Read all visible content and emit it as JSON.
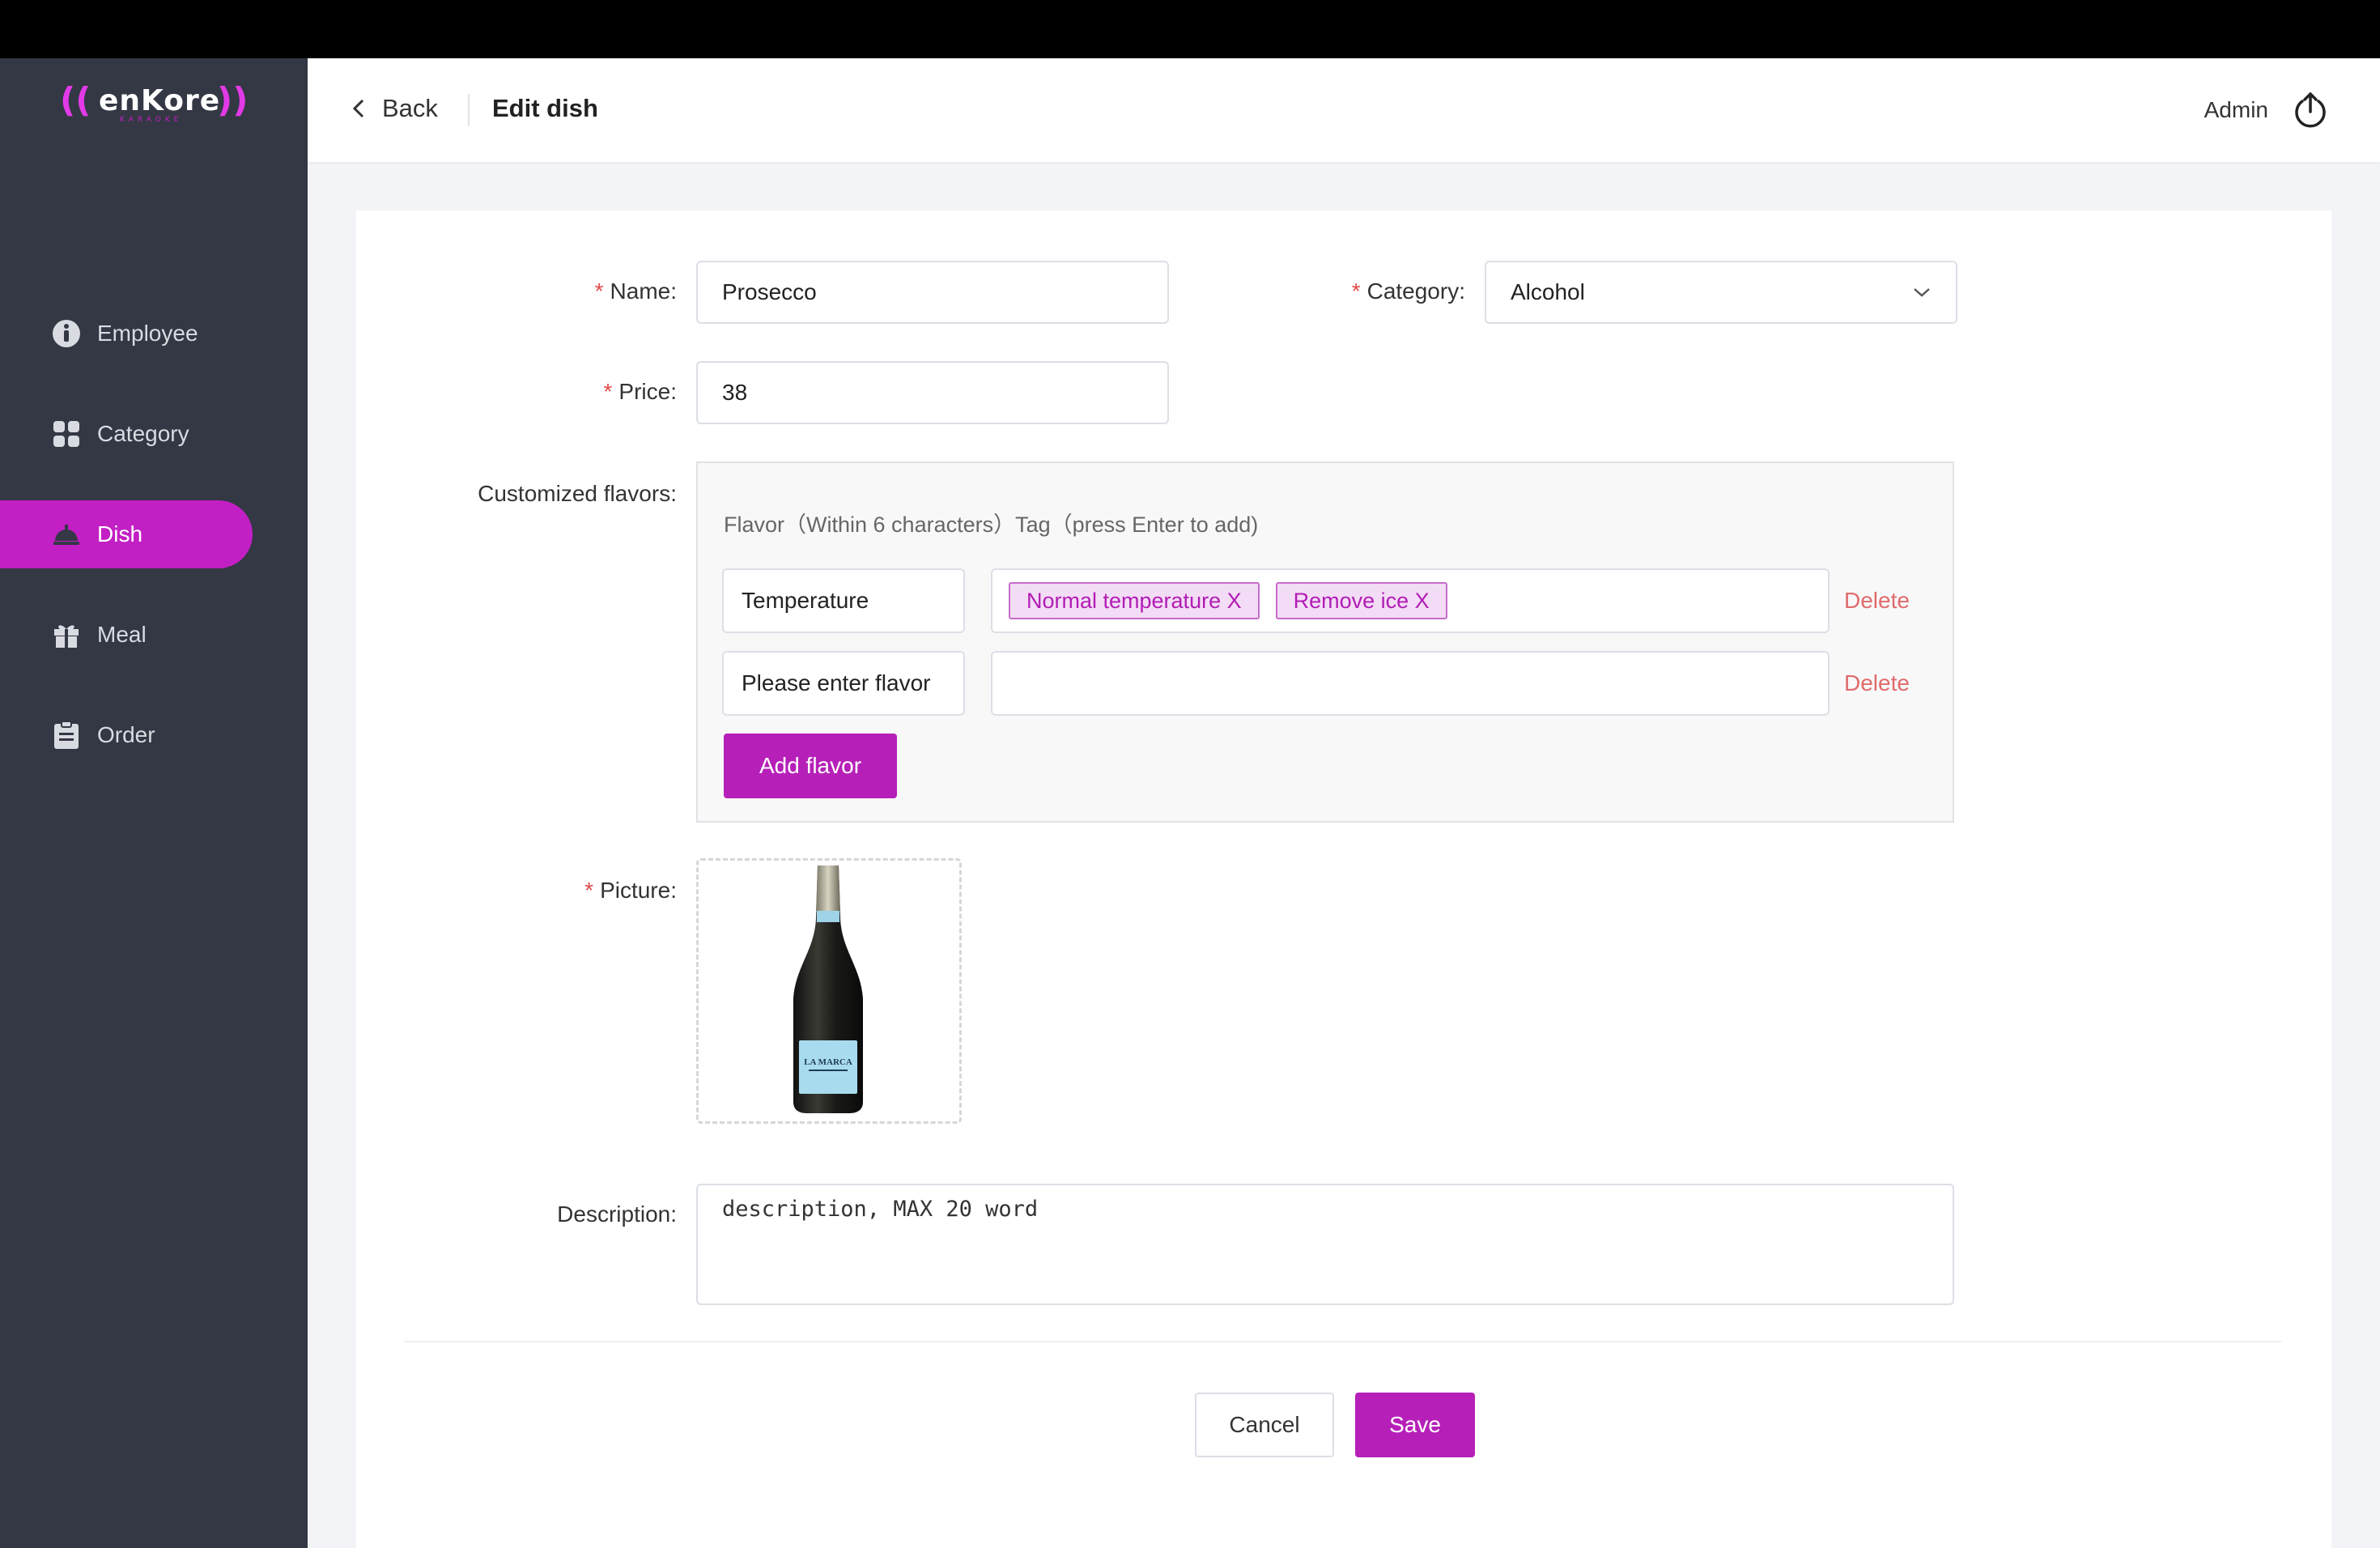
{
  "app": {
    "logo": "((enKore))",
    "logo_sub": "KARAOKE"
  },
  "sidebar": {
    "items": [
      {
        "label": "Employee",
        "icon": "employee-icon",
        "active": false
      },
      {
        "label": "Category",
        "icon": "category-icon",
        "active": false
      },
      {
        "label": "Dish",
        "icon": "dish-icon",
        "active": true
      },
      {
        "label": "Meal",
        "icon": "gift-icon",
        "active": false
      },
      {
        "label": "Order",
        "icon": "clipboard-icon",
        "active": false
      }
    ]
  },
  "header": {
    "back_label": "Back",
    "title": "Edit dish",
    "user": "Admin"
  },
  "form": {
    "name": {
      "label": "Name:",
      "value": "Prosecco"
    },
    "category": {
      "label": "Category:",
      "value": "Alcohol"
    },
    "price": {
      "label": "Price:",
      "value": "38"
    },
    "flavors": {
      "label": "Customized flavors:",
      "hint": "Flavor（Within 6 characters）Tag（press Enter to add)",
      "rows": [
        {
          "name": "Temperature",
          "placeholder": "",
          "tags": [
            "Normal temperature X",
            "Remove ice X"
          ],
          "delete": "Delete"
        },
        {
          "name": "",
          "placeholder": "Please enter flavor",
          "tags": [],
          "delete": "Delete"
        }
      ],
      "add_label": "Add flavor"
    },
    "picture": {
      "label": "Picture:",
      "alt": "LA MARCA"
    },
    "description": {
      "label": "Description:",
      "placeholder": "description, MAX 20 word"
    }
  },
  "actions": {
    "cancel": "Cancel",
    "save": "Save"
  },
  "colors": {
    "accent": "#b620b8",
    "sidebar": "#343744",
    "danger": "#e04a4a"
  }
}
